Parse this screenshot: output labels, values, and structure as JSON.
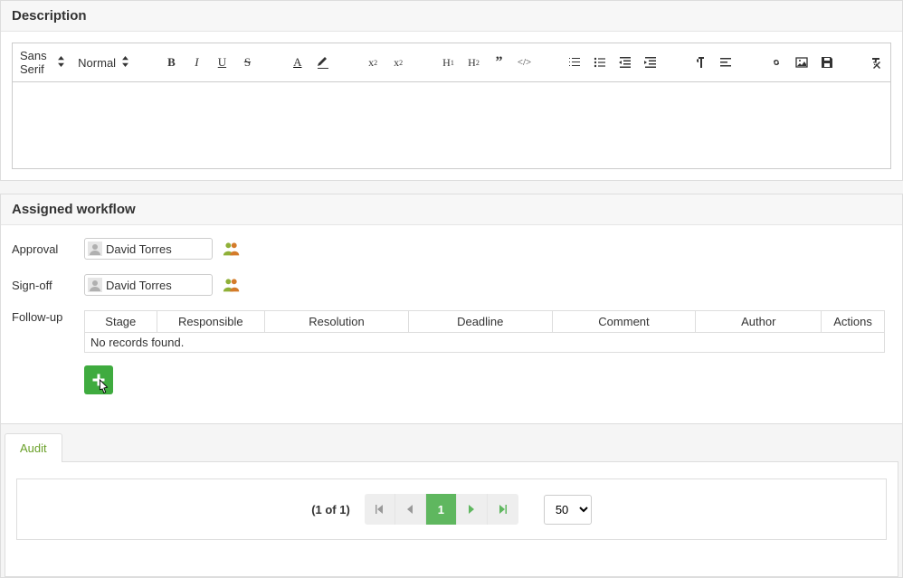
{
  "description": {
    "title": "Description",
    "font_family": "Sans Serif",
    "font_size": "Normal"
  },
  "workflow": {
    "title": "Assigned workflow",
    "rows": {
      "approval": {
        "label": "Approval",
        "assignee": "David Torres"
      },
      "signoff": {
        "label": "Sign-off",
        "assignee": "David Torres"
      },
      "followup": {
        "label": "Follow-up"
      }
    },
    "followup_table": {
      "columns": [
        "Stage",
        "Responsible",
        "Resolution",
        "Deadline",
        "Comment",
        "Author",
        "Actions"
      ],
      "empty_text": "No records found."
    }
  },
  "audit": {
    "tab_label": "Audit",
    "pager_text": "(1 of 1)",
    "current_page": "1",
    "page_size": "50"
  }
}
